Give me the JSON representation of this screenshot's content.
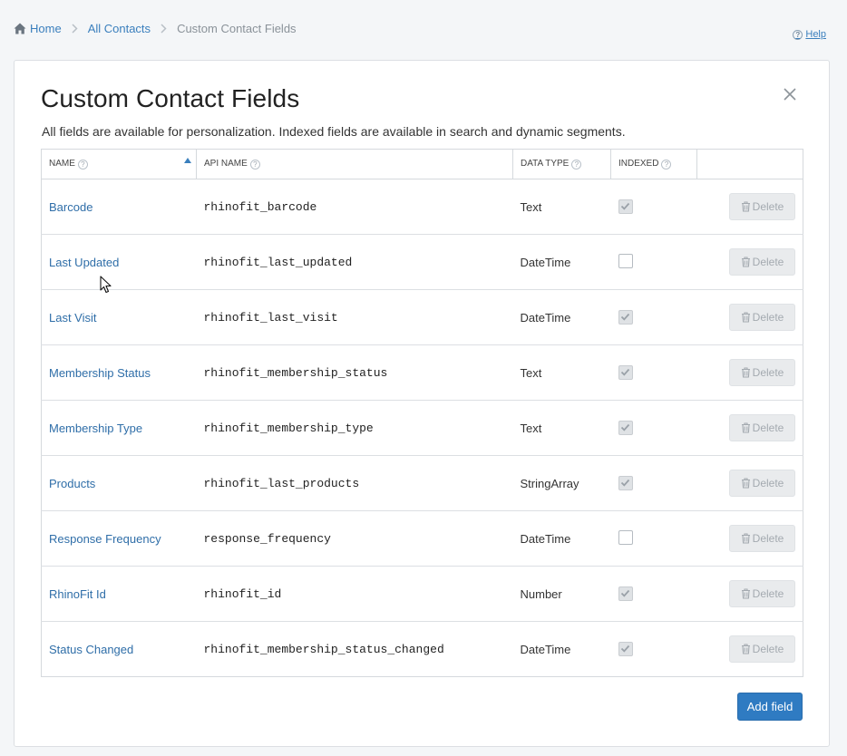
{
  "breadcrumb": {
    "home": "Home",
    "all_contacts": "All Contacts",
    "current": "Custom Contact Fields"
  },
  "help": {
    "label": "Help",
    "icon": "help-circle-icon"
  },
  "panel": {
    "title": "Custom Contact Fields",
    "description": "All fields are available for personalization. Indexed fields are available in search and dynamic segments.",
    "close_icon": "close-icon"
  },
  "table": {
    "headers": {
      "name": "NAME",
      "api_name": "API NAME",
      "data_type": "DATA TYPE",
      "indexed": "INDEXED"
    },
    "sort": {
      "column": "name",
      "direction": "ascending"
    },
    "delete_label": "Delete",
    "rows": [
      {
        "name": "Barcode",
        "api_name": "rhinofit_barcode",
        "data_type": "Text",
        "indexed": true
      },
      {
        "name": "Last Updated",
        "api_name": "rhinofit_last_updated",
        "data_type": "DateTime",
        "indexed": false
      },
      {
        "name": "Last Visit",
        "api_name": "rhinofit_last_visit",
        "data_type": "DateTime",
        "indexed": true
      },
      {
        "name": "Membership Status",
        "api_name": "rhinofit_membership_status",
        "data_type": "Text",
        "indexed": true
      },
      {
        "name": "Membership Type",
        "api_name": "rhinofit_membership_type",
        "data_type": "Text",
        "indexed": true
      },
      {
        "name": "Products",
        "api_name": "rhinofit_last_products",
        "data_type": "StringArray",
        "indexed": true
      },
      {
        "name": "Response Frequency",
        "api_name": "response_frequency",
        "data_type": "DateTime",
        "indexed": false
      },
      {
        "name": "RhinoFit Id",
        "api_name": "rhinofit_id",
        "data_type": "Number",
        "indexed": true
      },
      {
        "name": "Status Changed",
        "api_name": "rhinofit_membership_status_changed",
        "data_type": "DateTime",
        "indexed": true
      }
    ]
  },
  "add_button": {
    "label": "Add field"
  },
  "colors": {
    "link": "#2f6ea8",
    "primary_button": "#2f7bc2",
    "disabled_button": "#e9ebed",
    "page_background": "#f4f6f8"
  }
}
